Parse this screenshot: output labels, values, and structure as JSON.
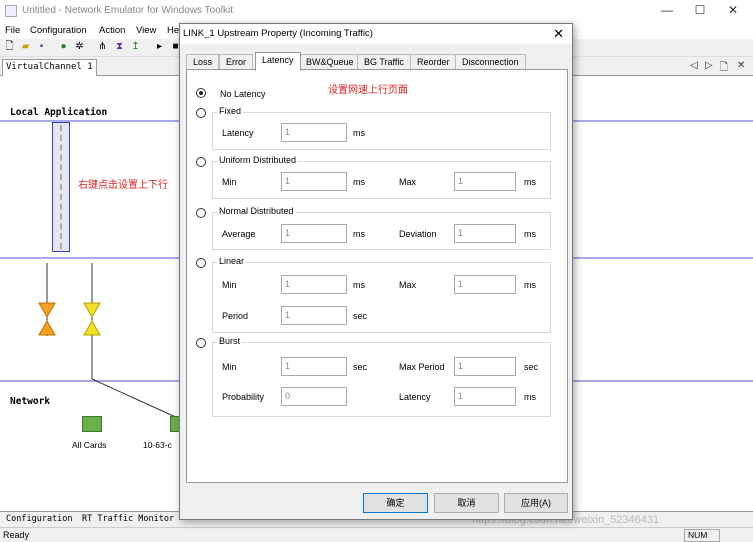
{
  "window": {
    "title": "Untitled - Network Emulator for Windows Toolkit"
  },
  "menu": [
    "File",
    "Configuration",
    "Action",
    "View",
    "He"
  ],
  "document_tab": "VirtualChannel 1",
  "canvas": {
    "local_application": "Local Application",
    "network": "Network",
    "annotation_right_click": "右键点击设置上下行",
    "device_all_cards": "All Cards",
    "device_partial": "10-63-c"
  },
  "bottom_tabs": [
    "Configuration",
    "RT Traffic Monitor"
  ],
  "status": {
    "ready": "Ready",
    "num": "NUM"
  },
  "watermark": "https://blog.csdn.net/weixin_52346431",
  "dialog": {
    "title": "LINK_1 Upstream Property (Incoming Traffic)",
    "tabs": [
      "Loss",
      "Error",
      "Latency",
      "BW&Queue",
      "BG Traffic",
      "Reorder",
      "Disconnection"
    ],
    "active_tab": "Latency",
    "annotation": "设置网速上行页面",
    "no_latency": "No Latency",
    "fixed": {
      "title": "Fixed",
      "latency_label": "Latency",
      "latency_value": "1",
      "unit": "ms"
    },
    "uniform": {
      "title": "Uniform Distributed",
      "min_label": "Min",
      "min_value": "1",
      "max_label": "Max",
      "max_value": "1",
      "unit": "ms"
    },
    "normal": {
      "title": "Normal Distributed",
      "avg_label": "Average",
      "avg_value": "1",
      "dev_label": "Deviation",
      "dev_value": "1",
      "unit": "ms"
    },
    "linear": {
      "title": "Linear",
      "min_label": "Min",
      "min_value": "1",
      "max_label": "Max",
      "max_value": "1",
      "unit": "ms",
      "period_label": "Period",
      "period_value": "1",
      "period_unit": "sec"
    },
    "burst": {
      "title": "Burst",
      "min_label": "Min",
      "min_value": "1",
      "min_unit": "sec",
      "maxp_label": "Max Period",
      "maxp_value": "1",
      "maxp_unit": "sec",
      "prob_label": "Probability",
      "prob_value": "0",
      "lat_label": "Latency",
      "lat_value": "1",
      "lat_unit": "ms"
    },
    "buttons": {
      "ok": "确定",
      "cancel": "取消",
      "apply": "应用(A)"
    }
  },
  "colors": {
    "annotation_red": "#e02020",
    "lane_line": "#a9a9e8",
    "default_button_border": "#0078d7"
  }
}
